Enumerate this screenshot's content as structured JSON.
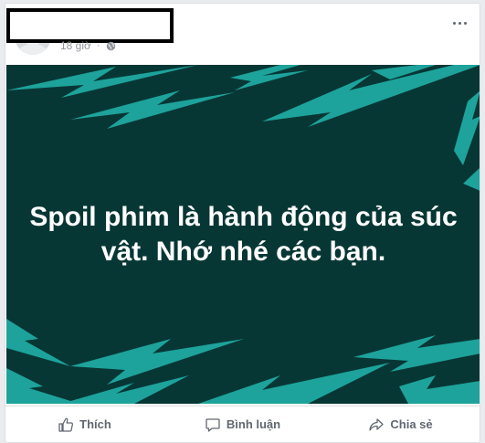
{
  "post": {
    "time": "18 giờ",
    "separator": "·",
    "image_text": "Spoil phim là hành động của súc vật. Nhớ nhé các bạn.",
    "colors": {
      "image_bg": "#073735",
      "bolt": "#1da39b",
      "text": "#ffffff"
    }
  },
  "actions": {
    "like_label": "Thích",
    "comment_label": "Bình luận",
    "share_label": "Chia sẻ"
  },
  "icons": {
    "avatar": "avatar",
    "privacy": "globe-icon",
    "options": "more-options-icon",
    "like": "thumbs-up-icon",
    "comment": "comment-bubble-icon",
    "share": "share-arrow-icon"
  }
}
